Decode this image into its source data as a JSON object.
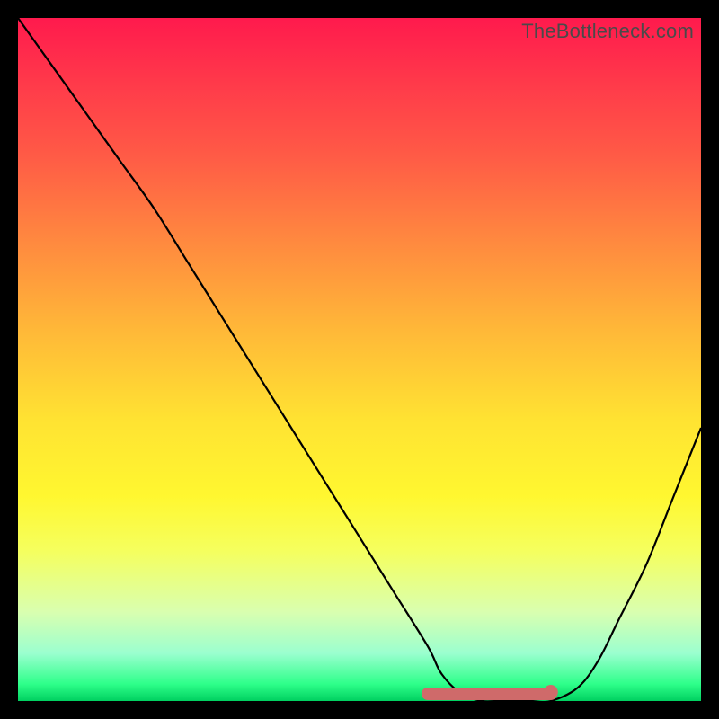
{
  "watermark": "TheBottleneck.com",
  "chart_data": {
    "type": "line",
    "title": "",
    "xlabel": "",
    "ylabel": "",
    "xlim": [
      0,
      100
    ],
    "ylim": [
      0,
      100
    ],
    "x": [
      0,
      5,
      10,
      15,
      20,
      25,
      30,
      35,
      40,
      45,
      50,
      55,
      60,
      62,
      65,
      68,
      70,
      72,
      75,
      78,
      82,
      85,
      88,
      92,
      96,
      100
    ],
    "values": [
      100,
      93,
      86,
      79,
      72,
      64,
      56,
      48,
      40,
      32,
      24,
      16,
      8,
      4,
      1,
      0,
      0,
      0,
      0,
      0,
      2,
      6,
      12,
      20,
      30,
      40
    ],
    "optimum_region_x": [
      60,
      78
    ],
    "description": "Bottleneck percentage curve: descends from 100% at x=0 to 0% near x≈68, stays near 0% until x≈78, then rises toward ~40% at x=100."
  },
  "colors": {
    "background": "#000000",
    "gradient_top": "#ff1a4d",
    "gradient_bottom": "#00d060",
    "curve": "#000000",
    "highlight": "#cf6a6a",
    "watermark": "#4a4a4a"
  }
}
